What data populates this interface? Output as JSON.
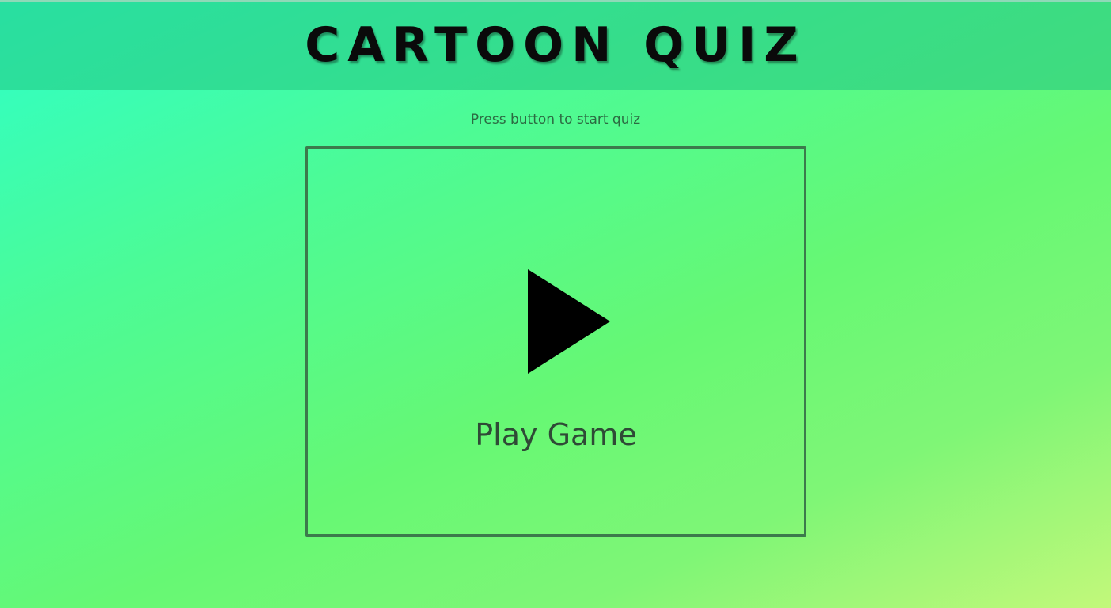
{
  "header": {
    "title": "CARTOON QUIZ"
  },
  "intro": {
    "instruction": "Press button to start quiz"
  },
  "play_card": {
    "icon": "play-icon",
    "label": "Play Game"
  },
  "colors": {
    "header_band": "#2fd59a",
    "card_border": "#3c7a4c",
    "play_icon": "#000000",
    "background_start": "#2effc8",
    "background_end": "#c2f87a"
  }
}
